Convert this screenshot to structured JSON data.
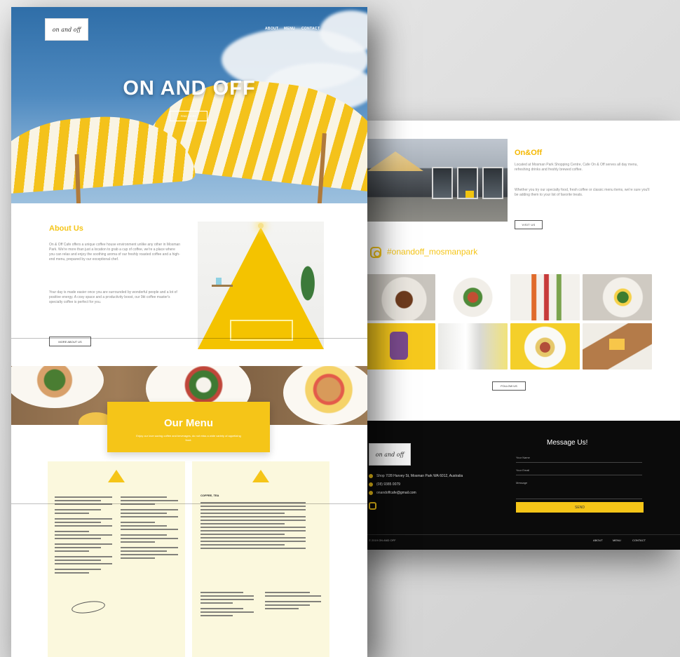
{
  "front": {
    "logo": "on and off",
    "nav": [
      "ABOUT",
      "MENU",
      "CONTACT"
    ],
    "hero_title": "ON AND OFF",
    "hero_button": "FIND MORE",
    "about": {
      "title": "About Us",
      "p1": "On & Off Cafe offers a unique coffee house environment unlike any other in Mosman Park. We're more than just a location to grab a cup of coffee, we're a place where you can relax and enjoy the soothing aroma of our freshly roasted coffee and a high-end menu, prepared by our exceptional chef.",
      "p2": "Your day is made easier once you are surrounded by wonderful people and a lot of positive energy. A cosy space and a productivity boost, our 9kt coffee master's specialty coffee is perfect for you.",
      "button": "MORE ABOUT US"
    },
    "menu": {
      "title": "Our Menu",
      "subtitle": "Enjoy our love saving coffee and beverages, do not miss a wide variety of appetizing food."
    },
    "sheet1": {
      "head_left": "",
      "head_right": ""
    },
    "sheet2": {
      "head": "COFFEE, TEA",
      "badge": "",
      "foot": ""
    }
  },
  "back": {
    "story": {
      "title": "On&Off",
      "p1": "Located at Mosman Park Shopping Centre, Cafe On & Off serves all day menu, refreshing drinks and freshly brewed coffee.",
      "p2": "Whether you try our specialty food, fresh coffee or classic menu items, we're sure you'll be adding them to your list of favorite treats.",
      "button": "VISIT US"
    },
    "instagram": {
      "handle": "#onandoff_mosmanpark",
      "button": "FOLLOW US"
    },
    "footer": {
      "logo": "on and off",
      "address": "Shop 7/28 Harvey St, Mosman Park WA 6012, Australia",
      "phone": "(08) 9385 0079",
      "email": "onandoffcafe@gmail.com",
      "message_title": "Message Us!",
      "field_name": "Your Name",
      "field_email": "Your Email",
      "field_message": "Message",
      "send": "SEND",
      "copyright": "© 2019 ON AND OFF",
      "nav": [
        "ABOUT",
        "MENU",
        "CONTACT"
      ]
    }
  }
}
